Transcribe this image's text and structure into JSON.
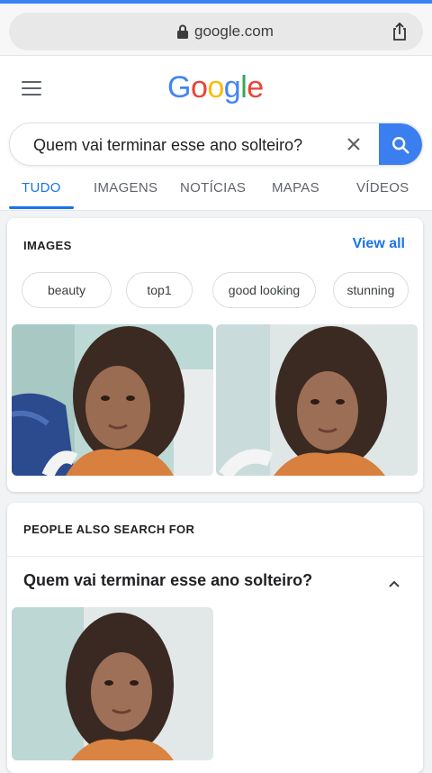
{
  "browser": {
    "url": "google.com",
    "lock_icon": "lock-icon",
    "share_icon": "share-icon"
  },
  "google": {
    "logo_letters": [
      {
        "char": "G",
        "color": "#4285F4"
      },
      {
        "char": "o",
        "color": "#EA4335"
      },
      {
        "char": "o",
        "color": "#FBBC05"
      },
      {
        "char": "g",
        "color": "#4285F4"
      },
      {
        "char": "l",
        "color": "#34A853"
      },
      {
        "char": "e",
        "color": "#EA4335"
      }
    ],
    "search_query": "Quem vai terminar esse ano solteiro?"
  },
  "tabs": [
    {
      "label": "TUDO",
      "active": true
    },
    {
      "label": "IMAGENS",
      "active": false
    },
    {
      "label": "NOTÍCIAS",
      "active": false
    },
    {
      "label": "MAPAS",
      "active": false
    },
    {
      "label": "VÍDEOS",
      "active": false
    }
  ],
  "images_card": {
    "title": "IMAGES",
    "view_all": "View all",
    "chips": [
      "beauty",
      "top1",
      "good looking",
      "stunning"
    ]
  },
  "people_card": {
    "title": "PEOPLE ALSO SEARCH FOR",
    "question": "Quem vai terminar esse ano solteiro?"
  },
  "colors": {
    "accent": "#1a73e8",
    "search_button": "#3b7ef0"
  }
}
